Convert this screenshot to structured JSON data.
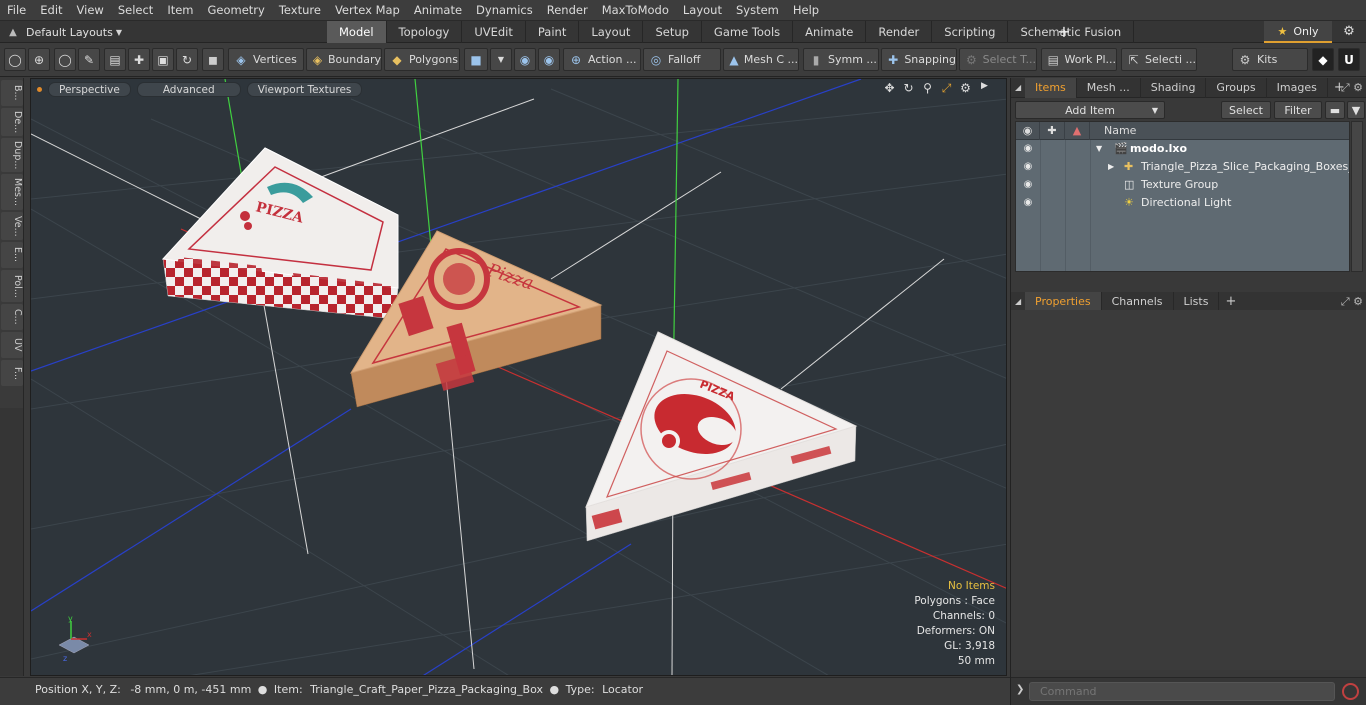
{
  "menu": [
    "File",
    "Edit",
    "View",
    "Select",
    "Item",
    "Geometry",
    "Texture",
    "Vertex Map",
    "Animate",
    "Dynamics",
    "Render",
    "MaxToModo",
    "Layout",
    "System",
    "Help"
  ],
  "layout": {
    "selector": "Default Layouts",
    "tabs": [
      "Model",
      "Topology",
      "UVEdit",
      "Paint",
      "Layout",
      "Setup",
      "Game Tools",
      "Animate",
      "Render",
      "Scripting",
      "Schematic Fusion"
    ],
    "active_tab": "Model",
    "only_label": "Only"
  },
  "toolbar": {
    "vertices": "Vertices",
    "boundary": "Boundary",
    "polygons": "Polygons",
    "action": "Action ...",
    "falloff": "Falloff",
    "mesh": "Mesh C ...",
    "symm": "Symm ...",
    "snapping": "Snapping",
    "select_t": "Select T...",
    "work_plane": "Work Pl...",
    "selection": "Selecti ...",
    "kits": "Kits"
  },
  "left_tabs": [
    "B...",
    "De...",
    "Dup...",
    "Mes...",
    "Ve...",
    "E...",
    "Pol...",
    "C...",
    "UV",
    "F..."
  ],
  "viewport": {
    "buttons": [
      "Perspective",
      "Advanced",
      "Viewport Textures"
    ],
    "info": {
      "no_items": "No Items",
      "polygons": "Polygons : Face",
      "channels": "Channels: 0",
      "deformers": "Deformers: ON",
      "gl": "GL: 3,918",
      "scale": "50 mm"
    },
    "box1_brand": "PIZZA",
    "box2_brand": "Pizza",
    "box3_brand": "PIZZA",
    "colors": {
      "background": "#2e353b",
      "grid": "#3c454c",
      "x_axis": "#c83030",
      "y_axis": "#40d040",
      "z_axis": "#2840c8"
    }
  },
  "status": {
    "position_label": "Position X, Y, Z:",
    "position_value": "-8 mm, 0 m, -451 mm",
    "item_label": "Item:",
    "item_value": "Triangle_Craft_Paper_Pizza_Packaging_Box",
    "type_label": "Type:",
    "type_value": "Locator"
  },
  "items_panel": {
    "tabs": [
      "Items",
      "Mesh ...",
      "Shading",
      "Groups",
      "Images"
    ],
    "active_tab": "Items",
    "add_item": "Add Item",
    "select": "Select",
    "filter": "Filter",
    "name_header": "Name",
    "tree": [
      {
        "name": "modo.lxo",
        "bold": true
      },
      {
        "name": "Triangle_Pizza_Slice_Packaging_Boxes_Set",
        "bold": false
      },
      {
        "name": "Texture Group",
        "bold": false
      },
      {
        "name": "Directional Light",
        "bold": false
      }
    ]
  },
  "props_panel": {
    "tabs": [
      "Properties",
      "Channels",
      "Lists"
    ],
    "active_tab": "Properties"
  },
  "command": {
    "placeholder": "Command"
  }
}
